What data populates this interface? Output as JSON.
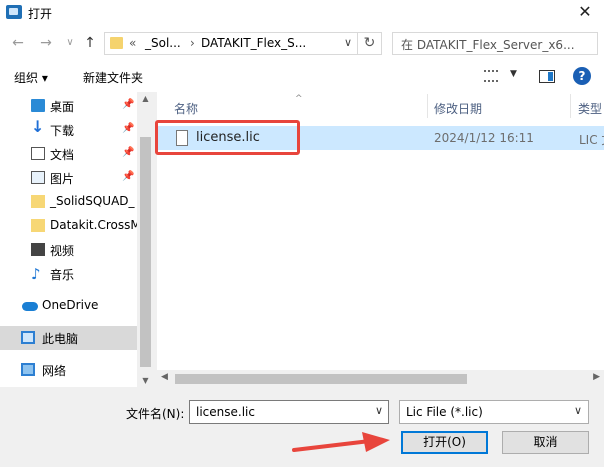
{
  "window": {
    "title": "打开",
    "close_glyph": "✕"
  },
  "nav": {
    "back": "←",
    "forward": "→",
    "recent": "∨",
    "up": "↑",
    "address": {
      "overflow": "«",
      "crumbs": [
        "_Sol...",
        "DATAKIT_Flex_S..."
      ],
      "separator": "›"
    },
    "refresh": "↻",
    "search_placeholder": "在 DATAKIT_Flex_Server_x6..."
  },
  "toolbar": {
    "organize": "组织 ▾",
    "new_folder": "新建文件夹",
    "help": "?"
  },
  "sidebar": {
    "items": [
      {
        "label": "桌面",
        "icon": "desktop-icon",
        "pinned": true
      },
      {
        "label": "下载",
        "icon": "download-icon",
        "pinned": true
      },
      {
        "label": "文档",
        "icon": "document-icon",
        "pinned": true
      },
      {
        "label": "图片",
        "icon": "pictures-icon",
        "pinned": true
      },
      {
        "label": "_SolidSQUAD_",
        "icon": "folder-icon",
        "pinned": false
      },
      {
        "label": "Datakit.CrossM",
        "icon": "folder-icon",
        "pinned": false
      },
      {
        "label": "视频",
        "icon": "video-icon",
        "pinned": false
      },
      {
        "label": "音乐",
        "icon": "music-icon",
        "pinned": false
      },
      {
        "label": "OneDrive",
        "icon": "onedrive-icon",
        "pinned": false
      },
      {
        "label": "此电脑",
        "icon": "computer-icon",
        "pinned": false,
        "selected": true
      },
      {
        "label": "网络",
        "icon": "network-icon",
        "pinned": false
      }
    ]
  },
  "columns": {
    "name": "名称",
    "modified": "修改日期",
    "type": "类型"
  },
  "files": [
    {
      "name": "license.lic",
      "modified": "2024/1/12 16:11",
      "type": "LIC 文"
    }
  ],
  "bottom": {
    "filename_label": "文件名(N):",
    "filename_value": "license.lic",
    "filetype_value": "Lic File (*.lic)",
    "open_button": "打开(O)",
    "cancel_button": "取消"
  },
  "colors": {
    "highlight": "#e8453c",
    "selection": "#cce8ff",
    "accent": "#0078d7"
  }
}
